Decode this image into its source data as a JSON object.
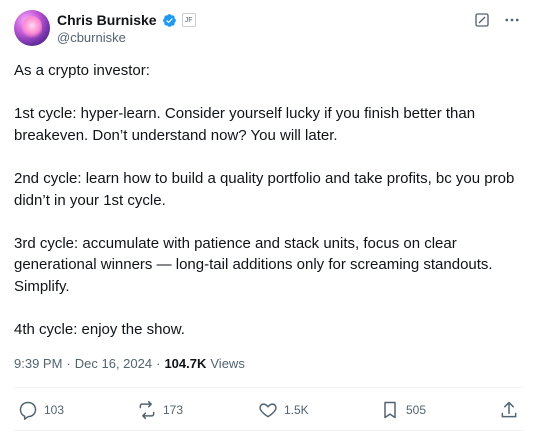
{
  "author": {
    "name": "Chris Burniske",
    "handle": "@cburniske",
    "verified": true,
    "affiliate_badge_text": "JF"
  },
  "tweet": {
    "paragraphs": [
      "As a crypto investor:",
      "1st cycle: hyper-learn. Consider yourself lucky if you finish better than breakeven. Don’t understand now? You will later.",
      "2nd cycle: learn how to build a quality portfolio and take profits, bc you prob didn’t in your 1st cycle.",
      "3rd cycle: accumulate with patience and stack units, focus on clear generational winners — long-tail additions only for screaming standouts. Simplify.",
      "4th cycle: enjoy the show."
    ]
  },
  "meta": {
    "time": "9:39 PM",
    "separator": "·",
    "date": "Dec 16, 2024",
    "views_count": "104.7K",
    "views_label": "Views"
  },
  "actions": {
    "replies": "103",
    "reposts": "173",
    "likes": "1.5K",
    "bookmarks": "505"
  },
  "colors": {
    "text": "#0f1419",
    "secondary": "#536471",
    "verified_blue": "#1d9bf0",
    "divider": "#eff3f4"
  }
}
